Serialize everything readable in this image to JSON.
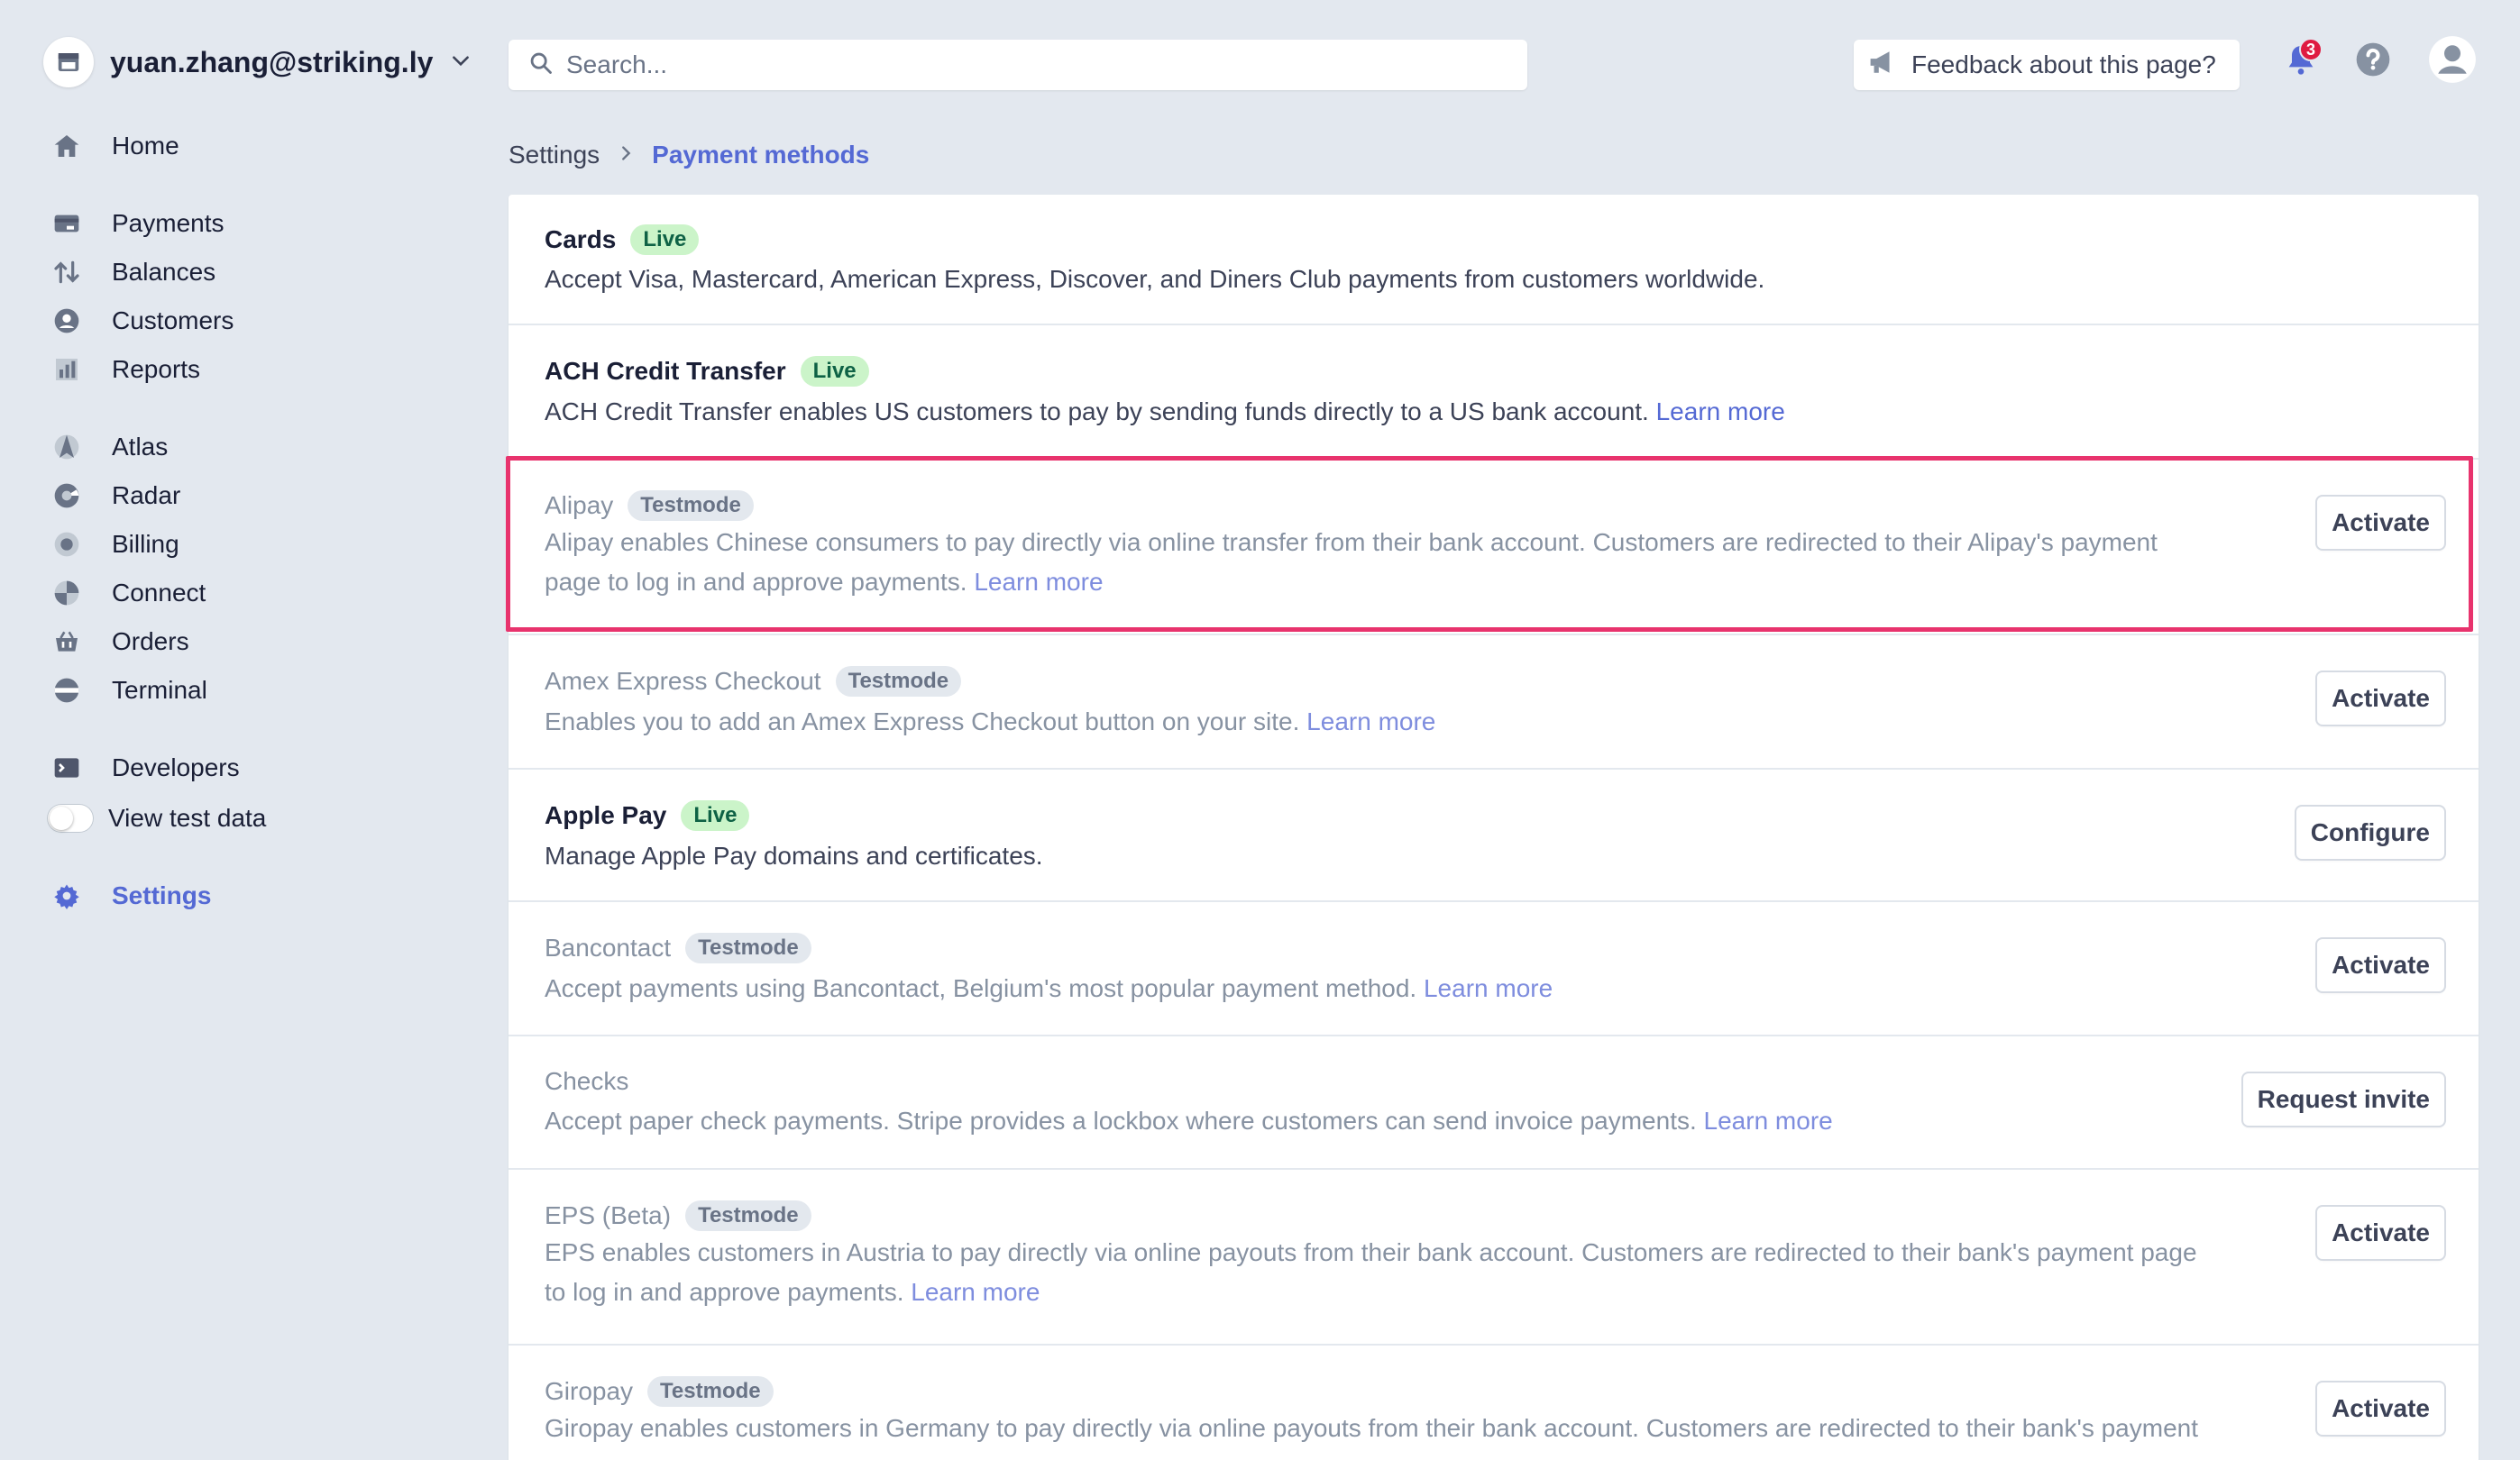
{
  "account": {
    "name": "yuan.zhang@striking.ly"
  },
  "sidebar": {
    "items": [
      {
        "label": "Home",
        "icon": "home-icon"
      },
      {
        "label": "Payments",
        "icon": "payments-icon"
      },
      {
        "label": "Balances",
        "icon": "balances-icon"
      },
      {
        "label": "Customers",
        "icon": "customers-icon"
      },
      {
        "label": "Reports",
        "icon": "reports-icon"
      },
      {
        "label": "Atlas",
        "icon": "atlas-icon"
      },
      {
        "label": "Radar",
        "icon": "radar-icon"
      },
      {
        "label": "Billing",
        "icon": "billing-icon"
      },
      {
        "label": "Connect",
        "icon": "connect-icon"
      },
      {
        "label": "Orders",
        "icon": "orders-icon"
      },
      {
        "label": "Terminal",
        "icon": "terminal-icon"
      },
      {
        "label": "Developers",
        "icon": "developers-icon"
      },
      {
        "label": "View test data",
        "icon": "toggle"
      },
      {
        "label": "Settings",
        "icon": "gear-icon"
      }
    ]
  },
  "search": {
    "placeholder": "Search..."
  },
  "feedback": {
    "label": "Feedback about this page?"
  },
  "notifications": {
    "count": "3"
  },
  "breadcrumb": {
    "root": "Settings",
    "current": "Payment methods"
  },
  "colors": {
    "accent": "#5469d4",
    "live_bg": "#cbf4c9",
    "live_fg": "#0e6245",
    "highlight": "#e8336d"
  },
  "methods": [
    {
      "title": "Cards",
      "status": "Live",
      "desc": "Accept Visa, Mastercard, American Express, Discover, and Diners Club payments from customers worldwide.",
      "desc2": "",
      "learn": "",
      "button": ""
    },
    {
      "title": "ACH Credit Transfer",
      "status": "Live",
      "desc": "ACH Credit Transfer enables US customers to pay by sending funds directly to a US bank account.",
      "desc2": "",
      "learn": "Learn more",
      "button": ""
    },
    {
      "title": "Alipay",
      "status": "Testmode",
      "desc": "Alipay enables Chinese consumers to pay directly via online transfer from their bank account. Customers are redirected to their Alipay's payment",
      "desc2": "page to log in and approve payments.",
      "learn": "Learn more",
      "button": "Activate"
    },
    {
      "title": "Amex Express Checkout",
      "status": "Testmode",
      "desc": "Enables you to add an Amex Express Checkout button on your site.",
      "desc2": "",
      "learn": "Learn more",
      "button": "Activate"
    },
    {
      "title": "Apple Pay",
      "status": "Live",
      "desc": "Manage Apple Pay domains and certificates.",
      "desc2": "",
      "learn": "",
      "button": "Configure"
    },
    {
      "title": "Bancontact",
      "status": "Testmode",
      "desc": "Accept payments using Bancontact, Belgium's most popular payment method.",
      "desc2": "",
      "learn": "Learn more",
      "button": "Activate"
    },
    {
      "title": "Checks",
      "status": "",
      "desc": "Accept paper check payments. Stripe provides a lockbox where customers can send invoice payments.",
      "desc2": "",
      "learn": "Learn more",
      "button": "Request invite"
    },
    {
      "title": "EPS (Beta)",
      "status": "Testmode",
      "desc": "EPS enables customers in Austria to pay directly via online payouts from their bank account. Customers are redirected to their bank's payment page",
      "desc2": "to log in and approve payments.",
      "learn": "Learn more",
      "button": "Activate"
    },
    {
      "title": "Giropay",
      "status": "Testmode",
      "desc": "Giropay enables customers in Germany to pay directly via online payouts from their bank account. Customers are redirected to their bank's payment",
      "desc2": "",
      "learn": "",
      "button": "Activate"
    }
  ]
}
